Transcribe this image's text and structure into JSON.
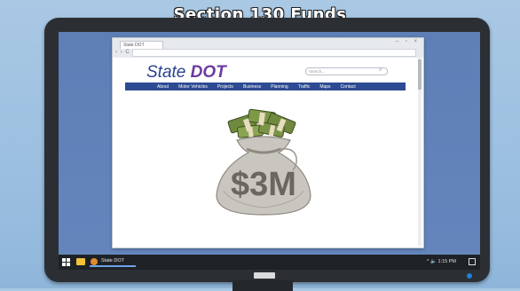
{
  "overlay_title": "Section 130 Funds",
  "browser": {
    "tab_label": "State DOT",
    "window_controls": "– ▫ ×",
    "nav_buttons": "‹ › C"
  },
  "site": {
    "logo_text_1": "State ",
    "logo_text_2": "DOT",
    "search_placeholder": "Search...",
    "nav": [
      "About",
      "Motor Vehicles",
      "Projects",
      "Business",
      "Planning",
      "Traffic",
      "Maps",
      "Contact"
    ]
  },
  "illustration": {
    "bag_label": "$3M",
    "icon": "money-bag-icon"
  },
  "taskbar": {
    "app_label": "State DOT",
    "tray_text": "^ 🔈 1:15 PM"
  },
  "colors": {
    "logo": "#2a3f8e",
    "logo_accent": "#6b3aa0",
    "navbar": "#2d4b92",
    "desktop": "#6486bd"
  }
}
